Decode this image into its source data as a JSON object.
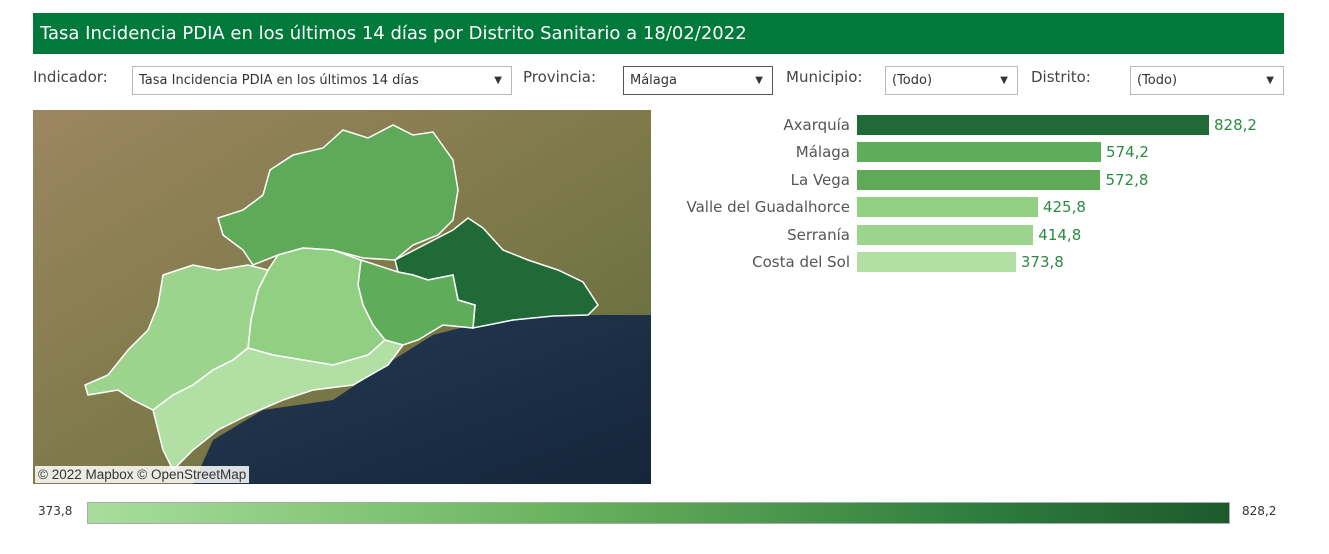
{
  "header": {
    "title": "Tasa Incidencia PDIA en los últimos 14 días por Distrito Sanitario a 18/02/2022"
  },
  "filters": {
    "indicador": {
      "label": "Indicador:",
      "value": "Tasa Incidencia PDIA en los últimos 14 días"
    },
    "provincia": {
      "label": "Provincia:",
      "value": "Málaga"
    },
    "municipio": {
      "label": "Municipio:",
      "value": "(Todo)"
    },
    "distrito": {
      "label": "Distrito:",
      "value": "(Todo)"
    },
    "arrow_glyph": "▼"
  },
  "map": {
    "credit": "© 2022 Mapbox  © OpenStreetMap",
    "colors": {
      "land": "#8c8a5a",
      "sea": "#1d3048",
      "axarquia": "#1f6a36",
      "malaga": "#5fad5a",
      "la_vega": "#5faa58",
      "guadalhorce": "#91cf83",
      "serrania": "#9dd48d",
      "costa_del_sol": "#b2e0a4"
    }
  },
  "chart_data": {
    "type": "bar",
    "orientation": "horizontal",
    "categories": [
      "Axarquía",
      "Málaga",
      "La Vega",
      "Valle del Guadalhorce",
      "Serranía",
      "Costa del Sol"
    ],
    "values": [
      828.2,
      574.2,
      572.8,
      425.8,
      414.8,
      373.8
    ],
    "value_labels": [
      "828,2",
      "574,2",
      "572,8",
      "425,8",
      "414,8",
      "373,8"
    ],
    "colors": [
      "#1f6a36",
      "#5fad5a",
      "#5faa58",
      "#91cf83",
      "#9dd48d",
      "#b2e0a4"
    ]
  },
  "legend": {
    "min_label": "373,8",
    "max_label": "828,2"
  }
}
